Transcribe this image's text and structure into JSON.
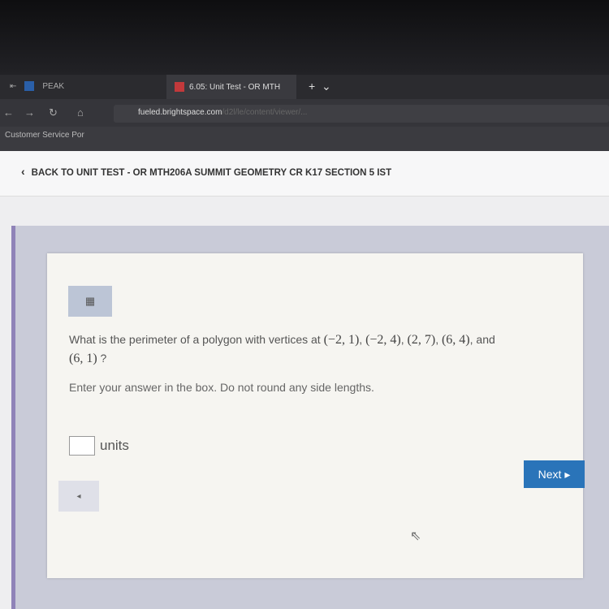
{
  "browser": {
    "tabs": [
      {
        "label": "PEAK"
      },
      {
        "label": "6.05: Unit Test - OR MTH",
        "active": true
      }
    ],
    "new_tab": "+",
    "tab_menu": "⌄",
    "url_host": "fueled.brightspace.com",
    "url_rest": "/d2l/le/content/viewer/...",
    "bookmark": "Customer Service Por"
  },
  "page": {
    "back_link": "BACK TO UNIT TEST - OR MTH206A SUMMIT GEOMETRY CR K17 SECTION 5 IST",
    "question_prefix": "What is the perimeter of a polygon with vertices at",
    "vertices": [
      "(−2, 1)",
      "(−2, 4)",
      "(2, 7)",
      "(6, 4)",
      "(6, 1)"
    ],
    "and": ", and",
    "question_suffix": "?",
    "instruction": "Enter your answer in the box. Do not round any side lengths.",
    "answer_value": "",
    "unit": "units",
    "next_label": "Next ▸",
    "prev_label": "◂"
  },
  "colors": {
    "next_button": "#2a74b9",
    "accent_border": "#8f83b8"
  }
}
